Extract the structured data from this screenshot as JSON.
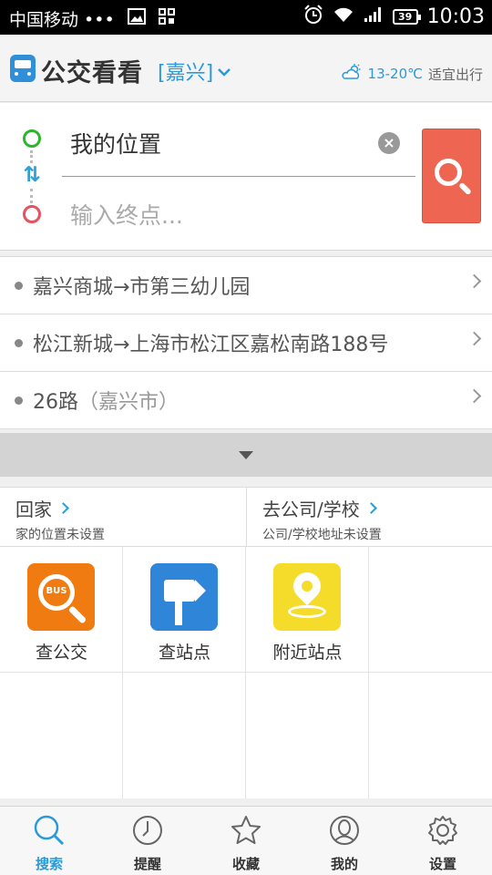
{
  "status_bar": {
    "carrier": "中国移动 •••",
    "battery": "39",
    "time": "10:03"
  },
  "header": {
    "app_title": "公交看看",
    "city": "[嘉兴]",
    "temperature": "13-20℃",
    "weather_tip": "适宜出行"
  },
  "search": {
    "start_value": "我的位置",
    "end_placeholder": "输入终点..."
  },
  "history": [
    {
      "text": "嘉兴商城→市第三幼儿园",
      "sub": ""
    },
    {
      "text": "松江新城→上海市松江区嘉松南路188号",
      "sub": ""
    },
    {
      "text": "26路",
      "sub": "（嘉兴市）"
    }
  ],
  "shortcuts": {
    "home": {
      "title": "回家",
      "desc": "家的位置未设置"
    },
    "work": {
      "title": "去公司/学校",
      "desc": "公司/学校地址未设置"
    }
  },
  "grid": [
    {
      "label": "查公交",
      "icon": "bus-search-icon",
      "color": "#f07b10"
    },
    {
      "label": "查站点",
      "icon": "signpost-icon",
      "color": "#2f86d8"
    },
    {
      "label": "附近站点",
      "icon": "location-pin-icon",
      "color": "#f5dc2a"
    }
  ],
  "tabs": [
    {
      "label": "搜索",
      "icon": "search-icon",
      "active": true
    },
    {
      "label": "提醒",
      "icon": "clock-icon",
      "active": false
    },
    {
      "label": "收藏",
      "icon": "star-icon",
      "active": false
    },
    {
      "label": "我的",
      "icon": "user-icon",
      "active": false
    },
    {
      "label": "设置",
      "icon": "gear-icon",
      "active": false
    }
  ],
  "colors": {
    "accent": "#2a9ad8",
    "search_button": "#ee6652"
  }
}
